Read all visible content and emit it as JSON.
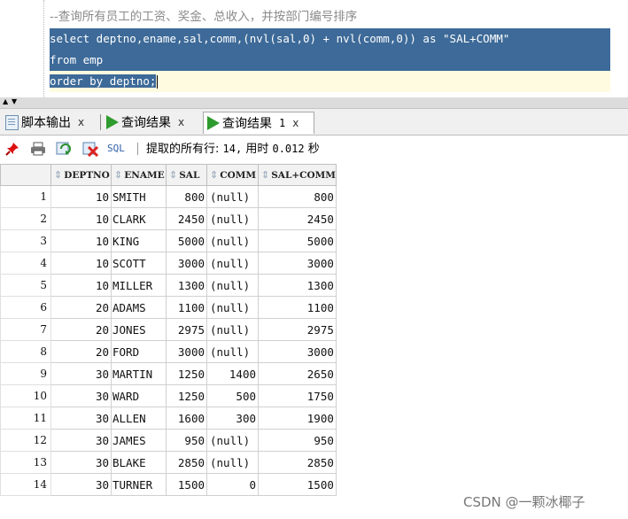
{
  "editor": {
    "comment": "--查询所有员工的工资、奖金、总收入，并按部门编号排序",
    "lines": [
      "select deptno,ename,sal,comm,(nvl(sal,0) + nvl(comm,0)) as \"SAL+COMM\"",
      "from emp",
      "order by deptno;"
    ]
  },
  "tabs": [
    {
      "label": "脚本输出",
      "close": "x"
    },
    {
      "label": "查询结果",
      "close": "x"
    },
    {
      "label": "查询结果",
      "num": "1",
      "close": "x"
    }
  ],
  "toolbar": {
    "sql_label": "SQL",
    "status_prefix": "提取的所有行: ",
    "rows": "14,",
    "time_label": " 用时 ",
    "time_value": "0.012",
    "time_unit": " 秒"
  },
  "grid": {
    "columns": [
      "DEPTNO",
      "ENAME",
      "SAL",
      "COMM",
      "SAL+COMM"
    ],
    "rows": [
      [
        "1",
        "10",
        "SMITH",
        "800",
        "(null)",
        "800"
      ],
      [
        "2",
        "10",
        "CLARK",
        "2450",
        "(null)",
        "2450"
      ],
      [
        "3",
        "10",
        "KING",
        "5000",
        "(null)",
        "5000"
      ],
      [
        "4",
        "10",
        "SCOTT",
        "3000",
        "(null)",
        "3000"
      ],
      [
        "5",
        "10",
        "MILLER",
        "1300",
        "(null)",
        "1300"
      ],
      [
        "6",
        "20",
        "ADAMS",
        "1100",
        "(null)",
        "1100"
      ],
      [
        "7",
        "20",
        "JONES",
        "2975",
        "(null)",
        "2975"
      ],
      [
        "8",
        "20",
        "FORD",
        "3000",
        "(null)",
        "3000"
      ],
      [
        "9",
        "30",
        "MARTIN",
        "1250",
        "1400",
        "2650"
      ],
      [
        "10",
        "30",
        "WARD",
        "1250",
        "500",
        "1750"
      ],
      [
        "11",
        "30",
        "ALLEN",
        "1600",
        "300",
        "1900"
      ],
      [
        "12",
        "30",
        "JAMES",
        "950",
        "(null)",
        "950"
      ],
      [
        "13",
        "30",
        "BLAKE",
        "2850",
        "(null)",
        "2850"
      ],
      [
        "14",
        "30",
        "TURNER",
        "1500",
        "0",
        "1500"
      ]
    ]
  },
  "watermark": "CSDN @一颗冰椰子",
  "colors": {
    "selection": "#3d6a98",
    "run_icon": "#2e9b2e",
    "sql_label": "#2f5fa8"
  }
}
